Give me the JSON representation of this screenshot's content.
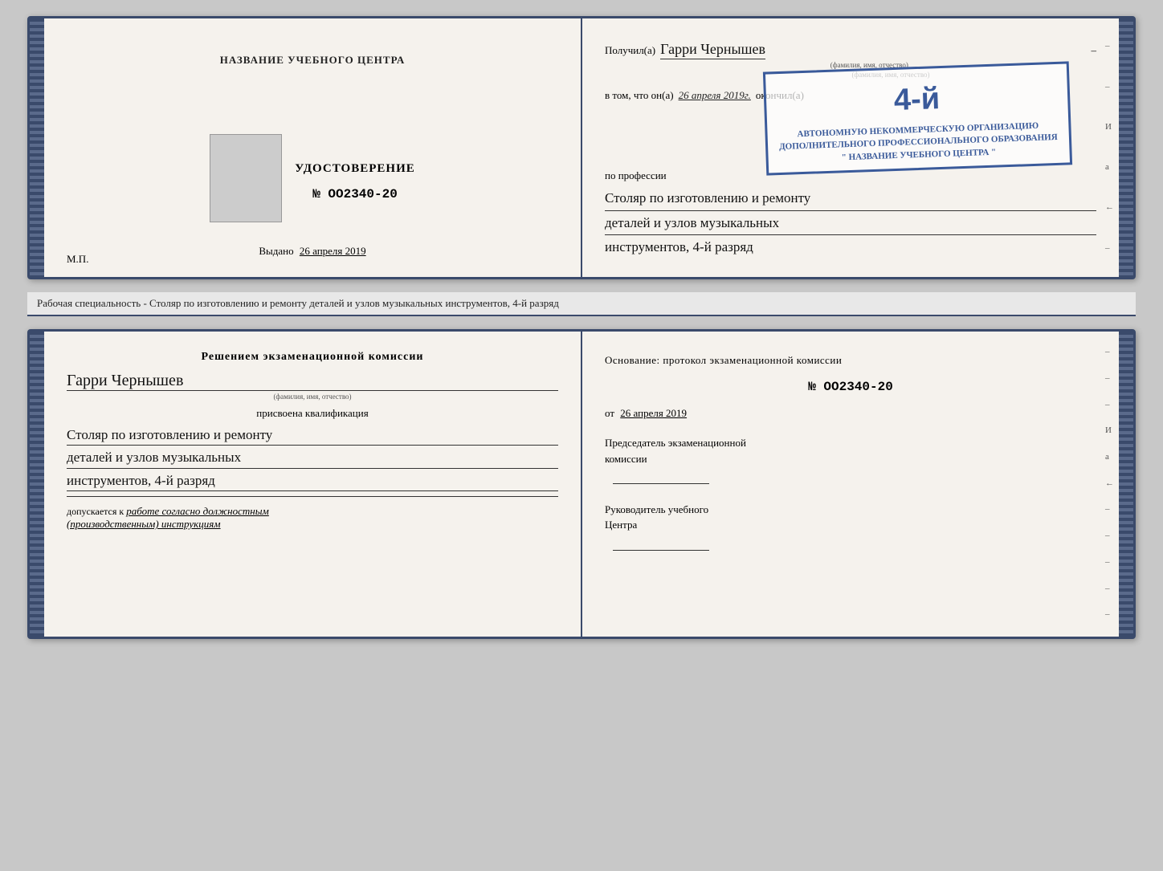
{
  "top_doc": {
    "left": {
      "institution_name": "НАЗВАНИЕ УЧЕБНОГО ЦЕНТРА",
      "certificate_label": "УДОСТОВЕРЕНИЕ",
      "cert_number": "№ OO2340-20",
      "issued_label": "Выдано",
      "issued_date": "26 апреля 2019",
      "mp_label": "М.П."
    },
    "right": {
      "recipient_prefix": "Получил(а)",
      "recipient_name": "Гарри Чернышев",
      "recipient_sublabel": "(фамилия, имя, отчество)",
      "date_prefix": "в том, что он(а)",
      "date_value": "26 апреля 2019г.",
      "finished_label": "окончил(а)",
      "stamp_big": "4-й",
      "stamp_line1": "АВТОНОМНУЮ НЕКОММЕРЧЕСКУЮ ОРГАНИЗАЦИЮ",
      "stamp_line2": "ДОПОЛНИТЕЛЬНОГО ПРОФЕССИОНАЛЬНОГО ОБРАЗОВАНИЯ",
      "stamp_line3": "\" НАЗВАНИЕ УЧЕБНОГО ЦЕНТРА \"",
      "profession_label": "по профессии",
      "profession_line1": "Столяр по изготовлению и ремонту",
      "profession_line2": "деталей и узлов музыкальных",
      "profession_line3": "инструментов, 4-й разряд"
    }
  },
  "description": "Рабочая специальность - Столяр по изготовлению и ремонту деталей и узлов музыкальных инструментов, 4-й разряд",
  "bottom_doc": {
    "left": {
      "commission_title": "Решением  экзаменационной  комиссии",
      "person_name": "Гарри Чернышев",
      "person_sublabel": "(фамилия, имя, отчество)",
      "assigned_label": "присвоена квалификация",
      "qualification_line1": "Столяр по изготовлению и ремонту",
      "qualification_line2": "деталей и узлов музыкальных",
      "qualification_line3": "инструментов, 4-й разряд",
      "allowed_prefix": "допускается к",
      "allowed_value": "работе согласно должностным",
      "allowed_value2": "(производственным) инструкциям"
    },
    "right": {
      "basis_label": "Основание: протокол  экзаменационной  комиссии",
      "protocol_number": "№  OO2340-20",
      "protocol_date_prefix": "от",
      "protocol_date": "26 апреля 2019",
      "chairman_label": "Председатель экзаменационной",
      "chairman_label2": "комиссии",
      "director_label": "Руководитель учебного",
      "director_label2": "Центра"
    }
  },
  "side_labels": {
    "И": "И",
    "а": "а",
    "arrow": "←",
    "dashes": [
      "-",
      "-",
      "-",
      "И",
      "а",
      "←",
      "-",
      "-",
      "-",
      "-",
      "-"
    ]
  }
}
